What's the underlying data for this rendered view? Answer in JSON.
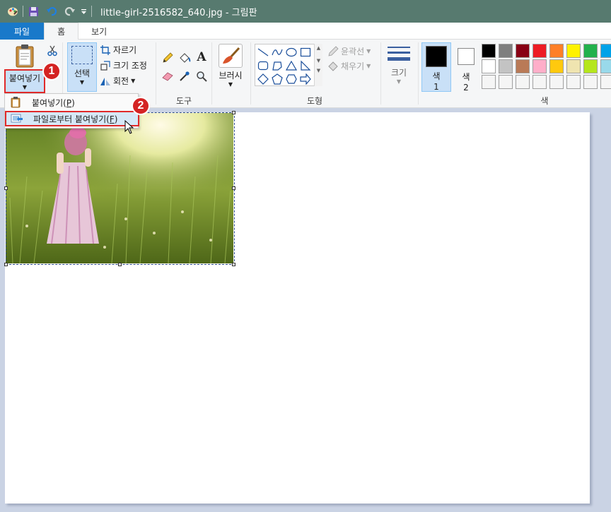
{
  "window": {
    "title": "little-girl-2516582_640.jpg - 그림판",
    "titlebar_color": "#577a6f",
    "quick_access": [
      "paint-app-icon",
      "save-icon",
      "undo-icon",
      "redo-icon",
      "customize-dropdown-icon"
    ]
  },
  "tabs": [
    {
      "label": "파일",
      "kind": "file"
    },
    {
      "label": "홈",
      "kind": "active"
    },
    {
      "label": "보기",
      "kind": "normal"
    }
  ],
  "ribbon": {
    "clipboard": {
      "paste_label": "붙여넣기",
      "cut_icon": "scissors-icon"
    },
    "image": {
      "select_label": "선택",
      "crop_label": "자르기",
      "resize_label": "크기 조정",
      "rotate_label": "회전"
    },
    "tools": {
      "label": "도구",
      "items": [
        "pencil-icon",
        "fill-bucket-icon",
        "text-icon",
        "eraser-icon",
        "color-picker-icon",
        "magnifier-icon"
      ]
    },
    "brushes": {
      "label": "브러시"
    },
    "shapes": {
      "label": "도형",
      "outline_label": "윤곽선",
      "fill_label": "채우기"
    },
    "size": {
      "label": "크기"
    },
    "colors": {
      "label": "색",
      "color1_label": "색",
      "color1_num": "1",
      "color2_label": "색",
      "color2_num": "2",
      "color1_value": "#000000",
      "color2_value": "#ffffff",
      "palette": [
        "#000000",
        "#7f7f7f",
        "#880015",
        "#ed1c24",
        "#ff7f27",
        "#fff200",
        "#22b14c",
        "#00a2e8",
        "#3f48cc",
        "#ffffff",
        "#c3c3c3",
        "#b97a57",
        "#ffaec9",
        "#ffc90e",
        "#efe4b0",
        "#b5e61d",
        "#99d9ea",
        "#7092be",
        "#f5f5f5",
        "#f5f5f5",
        "#f5f5f5",
        "#f5f5f5",
        "#f5f5f5",
        "#f5f5f5",
        "#f5f5f5",
        "#f5f5f5",
        "#f5f5f5"
      ]
    }
  },
  "paste_menu": {
    "items": [
      {
        "label": "붙여넣기(",
        "key": "P",
        "suffix": ")"
      },
      {
        "label": "파일로부터 붙여넣기(",
        "key": "F",
        "suffix": ")"
      }
    ]
  },
  "annotations": {
    "step1": "1",
    "step2": "2",
    "highlight_color": "#e02a2a"
  }
}
